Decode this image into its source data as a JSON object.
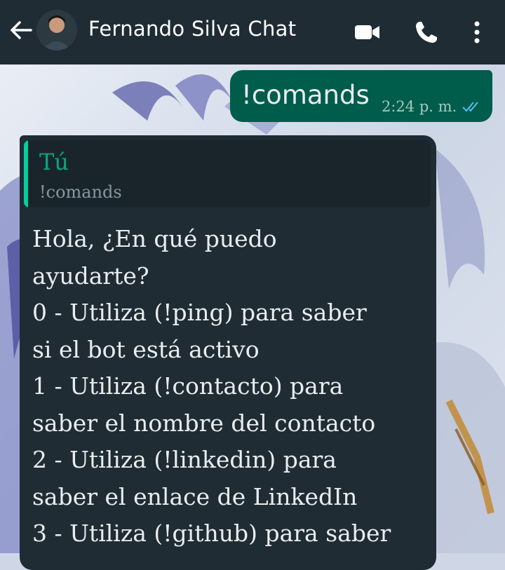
{
  "header": {
    "title": "Fernando Silva Chat",
    "icons": [
      "back-arrow-icon",
      "video-call-icon",
      "phone-icon",
      "more-options-icon"
    ]
  },
  "outgoing": {
    "text": "!comands",
    "time": "2:24 p. m.",
    "status_icon": "double-check-icon"
  },
  "incoming": {
    "quote_author": "Tú",
    "quote_text": "!comands",
    "lines": [
      "Hola, ¿En qué puedo",
      "ayudarte?",
      "0 - Utiliza (!ping) para saber",
      "si el bot está activo",
      "1 - Utiliza (!contacto) para",
      "saber el nombre del contacto",
      "2 - Utiliza (!linkedin) para",
      "saber el enlace de LinkedIn",
      "3 - Utiliza (!github) para saber"
    ]
  },
  "colors": {
    "header_bg": "#1f2c34",
    "outgoing_bg": "#005c4b",
    "incoming_bg": "#202c33",
    "quote_accent": "#06cf9c"
  }
}
